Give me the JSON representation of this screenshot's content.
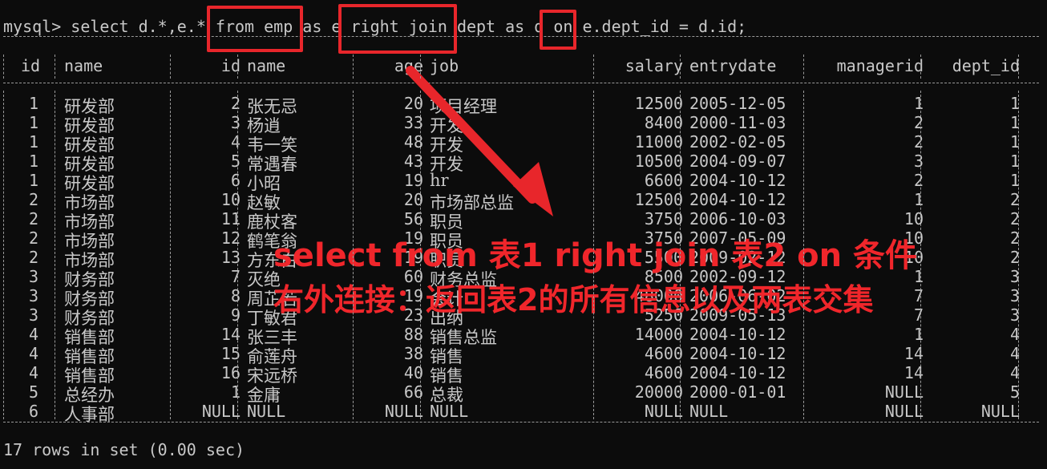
{
  "terminal": {
    "prompt": "mysql> ",
    "command": "select d.*,e.* from emp as e right join dept as d on e.dept_id = d.id;",
    "footer": "17 rows in set (0.00 sec)"
  },
  "table": {
    "columns": [
      "id",
      "name",
      "id",
      "name",
      "age",
      "job",
      "salary",
      "entrydate",
      "managerid",
      "dept_id"
    ],
    "rows": [
      [
        "1",
        "研发部",
        "2",
        "张无忌",
        "20",
        "项目经理",
        "12500",
        "2005-12-05",
        "1",
        "1"
      ],
      [
        "1",
        "研发部",
        "3",
        "杨逍",
        "33",
        "开发",
        "8400",
        "2000-11-03",
        "2",
        "1"
      ],
      [
        "1",
        "研发部",
        "4",
        "韦一笑",
        "48",
        "开发",
        "11000",
        "2002-02-05",
        "2",
        "1"
      ],
      [
        "1",
        "研发部",
        "5",
        "常遇春",
        "43",
        "开发",
        "10500",
        "2004-09-07",
        "3",
        "1"
      ],
      [
        "1",
        "研发部",
        "6",
        "小昭",
        "19",
        "hr",
        "6600",
        "2004-10-12",
        "2",
        "1"
      ],
      [
        "2",
        "市场部",
        "10",
        "赵敏",
        "20",
        "市场部总监",
        "12500",
        "2004-10-12",
        "1",
        "2"
      ],
      [
        "2",
        "市场部",
        "11",
        "鹿杖客",
        "56",
        "职员",
        "3750",
        "2006-10-03",
        "10",
        "2"
      ],
      [
        "2",
        "市场部",
        "12",
        "鹤笔翁",
        "19",
        "职员",
        "3750",
        "2007-05-09",
        "10",
        "2"
      ],
      [
        "2",
        "市场部",
        "13",
        "方东白",
        "19",
        "职员",
        "5500",
        "2009-02-12",
        "10",
        "2"
      ],
      [
        "3",
        "财务部",
        "7",
        "灭绝",
        "60",
        "财务总监",
        "8500",
        "2002-09-12",
        "1",
        "3"
      ],
      [
        "3",
        "财务部",
        "8",
        "周芷若",
        "19",
        "会计",
        "48000",
        "2006-06-02",
        "7",
        "3"
      ],
      [
        "3",
        "财务部",
        "9",
        "丁敏君",
        "23",
        "出纳",
        "5250",
        "2009-05-13",
        "7",
        "3"
      ],
      [
        "4",
        "销售部",
        "14",
        "张三丰",
        "88",
        "销售总监",
        "14000",
        "2004-10-12",
        "1",
        "4"
      ],
      [
        "4",
        "销售部",
        "15",
        "俞莲舟",
        "38",
        "销售",
        "4600",
        "2004-10-12",
        "14",
        "4"
      ],
      [
        "4",
        "销售部",
        "16",
        "宋远桥",
        "40",
        "销售",
        "4600",
        "2004-10-12",
        "14",
        "4"
      ],
      [
        "5",
        "总经办",
        "1",
        "金庸",
        "66",
        "总裁",
        "20000",
        "2000-01-01",
        "NULL",
        "5"
      ],
      [
        "6",
        "人事部",
        "NULL",
        "NULL",
        "NULL",
        "NULL",
        "NULL",
        "NULL",
        "NULL",
        "NULL"
      ]
    ]
  },
  "annotations": {
    "line1": "select from 表1 right join 表2 on 条件",
    "line2": "右外连接：返回表2的所有信息以及两表交集",
    "color": "#e8262b"
  }
}
